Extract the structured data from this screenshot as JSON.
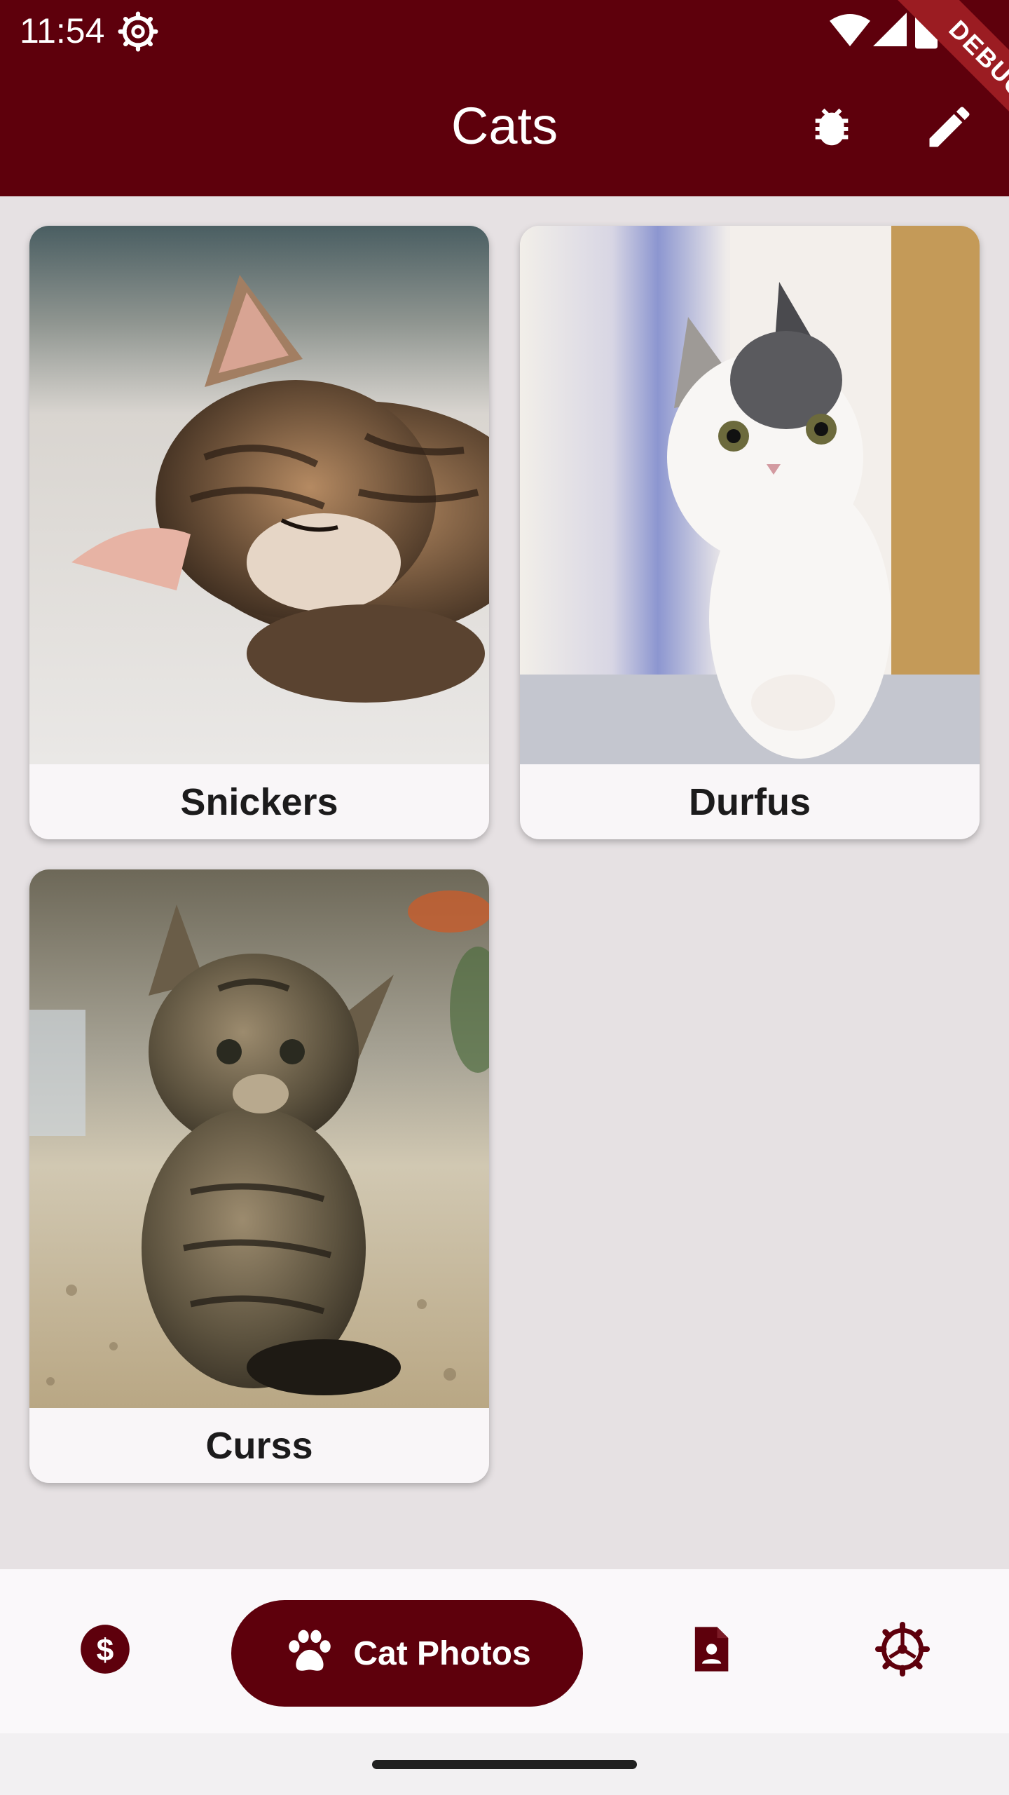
{
  "status_bar": {
    "time": "11:54",
    "debug_label": "DEBUG"
  },
  "app_bar": {
    "title": "Cats",
    "actions": [
      {
        "icon": "bug-icon"
      },
      {
        "icon": "edit-icon"
      }
    ]
  },
  "cats": [
    {
      "name": "Snickers",
      "photo": "sleeping tabby kitten"
    },
    {
      "name": "Durfus",
      "photo": "white and grey kitten peeking"
    },
    {
      "name": "Curss",
      "photo": "sitting tabby kitten"
    }
  ],
  "bottom_nav": {
    "items": [
      {
        "icon": "dollar-icon",
        "active": false
      },
      {
        "icon": "paw-icon",
        "label": "Cat Photos",
        "active": true
      },
      {
        "icon": "document-person-icon",
        "active": false
      },
      {
        "icon": "settings-icon",
        "active": false
      }
    ]
  },
  "colors": {
    "primary": "#5e000c",
    "background": "#e6e1e3",
    "card": "#f9f6f8",
    "ribbon": "#9b1c22"
  }
}
